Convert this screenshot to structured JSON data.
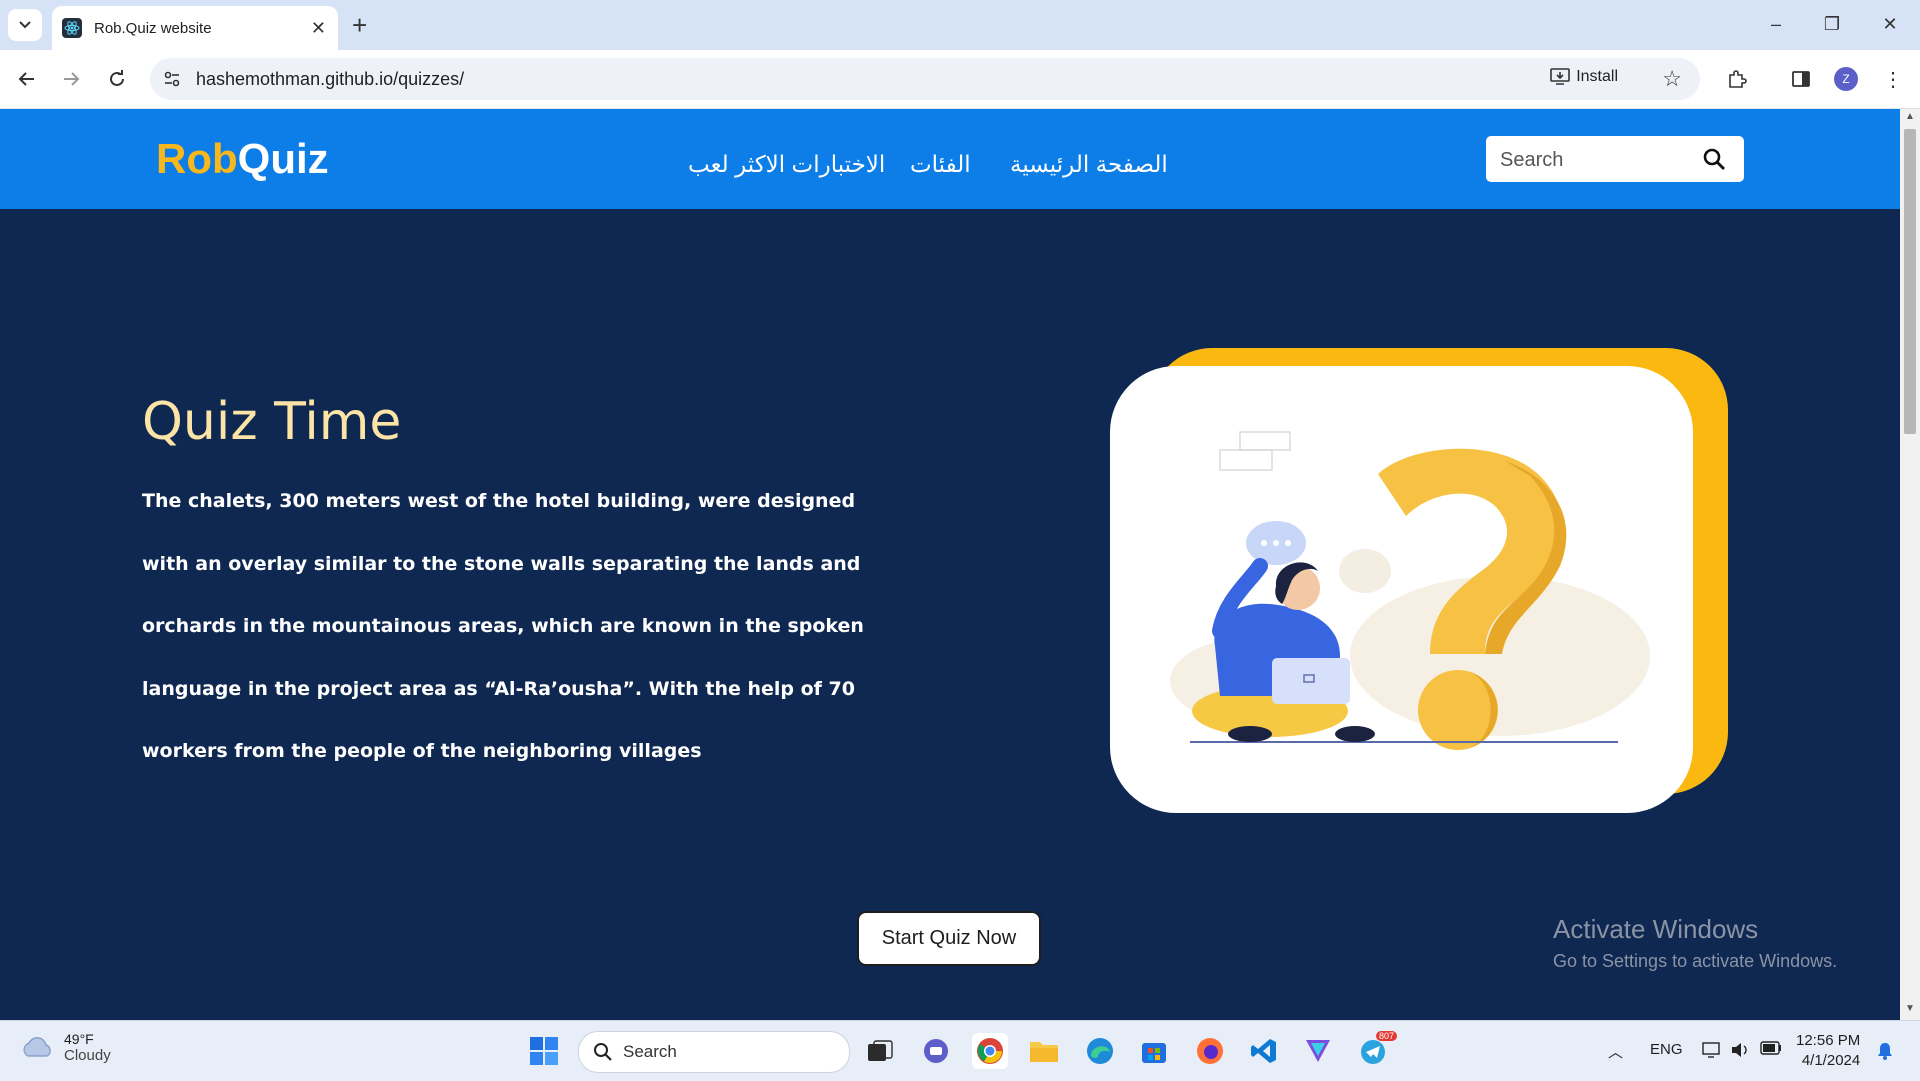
{
  "browser": {
    "tab_title": "Rob.Quiz website",
    "url": "hashemothman.github.io/quizzes/",
    "install_label": "Install",
    "profile_initial": "Z"
  },
  "header": {
    "logo_part1": "Rob",
    "logo_part2": "Quiz",
    "nav": [
      "الصفحة الرئيسية",
      "الفئات",
      "الاختبارات الاكثر لعب"
    ],
    "search_placeholder": "Search"
  },
  "hero": {
    "title": "Quiz Time",
    "paragraph": "The chalets, 300 meters west of the hotel building, were designed with an overlay similar to the stone walls separating the lands and orchards in the mountainous areas, which are known in the spoken language in the project area as “Al-Ra’ousha”. With the help of 70 workers from the people of the neighboring villages",
    "cta_label": "Start Quiz Now"
  },
  "watermark": {
    "line1": "Activate Windows",
    "line2": "Go to Settings to activate Windows."
  },
  "taskbar": {
    "weather_temp": "49°F",
    "weather_cond": "Cloudy",
    "search_label": "Search",
    "telegram_badge": "807",
    "lang": "ENG",
    "time": "12:56 PM",
    "date": "4/1/2024"
  },
  "colors": {
    "header_blue": "#0d7de8",
    "page_navy": "#0f2851",
    "logo_yellow": "#f8b81c",
    "card_yellow": "#fbb811",
    "title_cream": "#fbe4a6"
  }
}
